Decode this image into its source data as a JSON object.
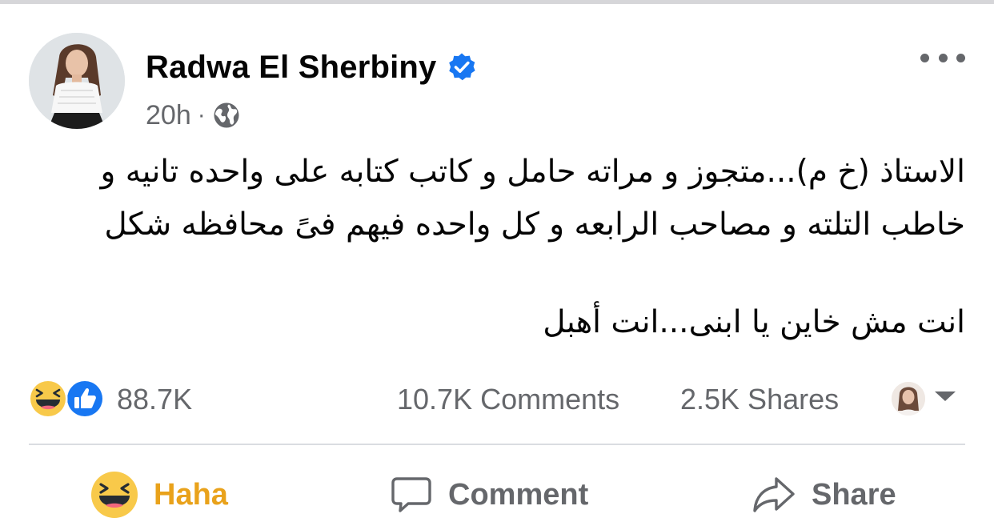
{
  "post": {
    "author": "Radwa El Sherbiny",
    "time": "20h",
    "separator": "·",
    "text_lines": [
      "الاستاذ (خ م)...متجوز و مراته حامل و كاتب كتابه على واحده تانيه و",
      "خاطب التلته و مصاحب الرابعه و كل واحده فيهم فىً محافظه شكل",
      "انت مش خاين يا ابنى...انت أهبل"
    ]
  },
  "reactions": {
    "count": "88.7K",
    "types": [
      "haha-icon",
      "like-icon"
    ]
  },
  "stats": {
    "comments": "10.7K Comments",
    "shares": "2.5K Shares"
  },
  "actions": {
    "reaction_label": "Haha",
    "comment_label": "Comment",
    "share_label": "Share"
  },
  "colors": {
    "verified": "#1877f2",
    "haha_active": "#e9a21b",
    "secondary_text": "#65676b",
    "like_blue": "#1877f2"
  }
}
